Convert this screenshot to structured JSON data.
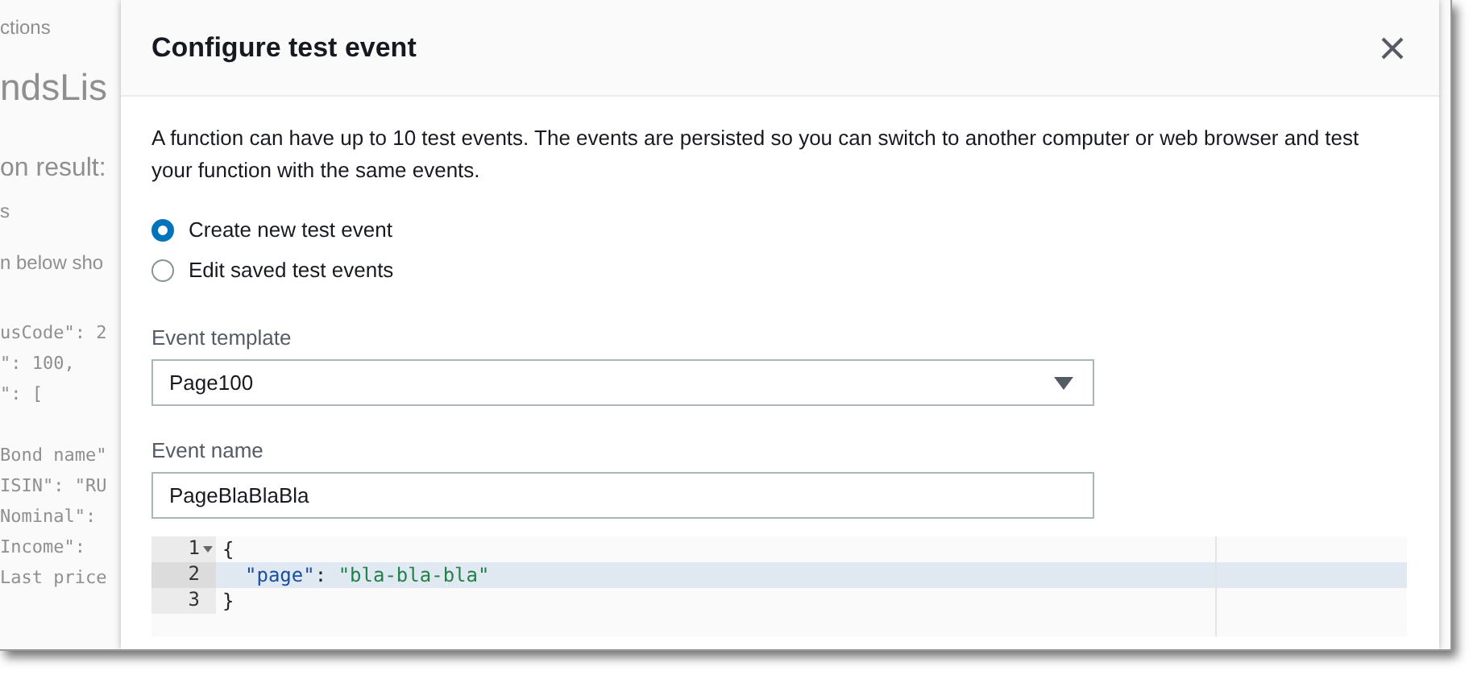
{
  "background": {
    "breadcrumb": "ctions",
    "title": "ndsLis",
    "section": "on result:",
    "tab": "s",
    "note": "n below sho",
    "code": [
      "usCode\": 2",
      "\": 100,",
      "\": [",
      "Bond name\"",
      "ISIN\": \"RU",
      "Nominal\":",
      "Income\":",
      "Last price"
    ]
  },
  "modal": {
    "title": "Configure test event",
    "description": "A function can have up to 10 test events. The events are persisted so you can switch to another computer or web browser and test your function with the same events.",
    "options": [
      {
        "label": "Create new test event",
        "selected": true
      },
      {
        "label": "Edit saved test events",
        "selected": false
      }
    ],
    "template": {
      "label": "Event template",
      "value": "Page100"
    },
    "event_name": {
      "label": "Event name",
      "value": "PageBlaBlaBla"
    },
    "editor": {
      "lines": [
        {
          "number": "1",
          "foldable": true,
          "active": false,
          "indented": false,
          "tokens": [
            {
              "kind": "punct",
              "text": "{"
            }
          ]
        },
        {
          "number": "2",
          "foldable": false,
          "active": true,
          "indented": true,
          "tokens": [
            {
              "kind": "key",
              "text": "\"page\""
            },
            {
              "kind": "punct",
              "text": ": "
            },
            {
              "kind": "string",
              "text": "\"bla-bla-bla\""
            }
          ]
        },
        {
          "number": "3",
          "foldable": false,
          "active": false,
          "indented": false,
          "tokens": [
            {
              "kind": "punct",
              "text": "}"
            }
          ]
        }
      ]
    }
  }
}
